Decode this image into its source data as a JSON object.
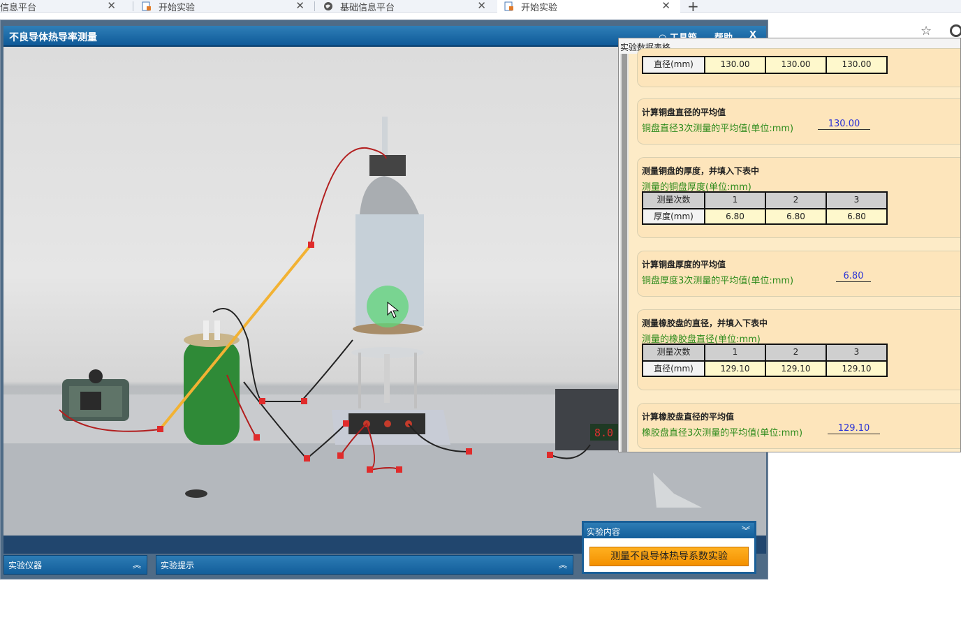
{
  "browser": {
    "tabs": [
      {
        "label": "信息平台"
      },
      {
        "label": "开始实验"
      },
      {
        "label": "基础信息平台"
      },
      {
        "label": "开始实验"
      }
    ],
    "new_tab_label": "+",
    "close_glyph": "✕"
  },
  "sim": {
    "title": "不良导体热导率测量",
    "toolbox_label": "工具箱",
    "help_label": "帮助",
    "close_label": "X",
    "bottom_panels": {
      "instruments_label": "实验仪器",
      "hints_label": "实验提示"
    },
    "content_panel": {
      "header": "实验内容",
      "run_button": "测量不良导体热导系数实验"
    },
    "display_value": "8.0"
  },
  "data_table": {
    "window_title": "实验数据表格",
    "copper_diameter_row": {
      "label": "直径(mm)",
      "values": [
        "130.00",
        "130.00",
        "130.00"
      ]
    },
    "copper_diameter_avg": {
      "title": "计算铜盘直径的平均值",
      "subtitle": "铜盘直径3次测量的平均值(单位:mm)",
      "value": "130.00"
    },
    "copper_thickness": {
      "title": "测量铜盘的厚度，并填入下表中",
      "subtitle": "测量的铜盘厚度(单位:mm)",
      "header": [
        "测量次数",
        "1",
        "2",
        "3"
      ],
      "row": [
        "厚度(mm)",
        "6.80",
        "6.80",
        "6.80"
      ]
    },
    "copper_thickness_avg": {
      "title": "计算铜盘厚度的平均值",
      "subtitle": "铜盘厚度3次测量的平均值(单位:mm)",
      "value": "6.80"
    },
    "rubber_diameter": {
      "title": "测量橡胶盘的直径，并填入下表中",
      "subtitle": "测量的橡胶盘直径(单位:mm)",
      "header": [
        "测量次数",
        "1",
        "2",
        "3"
      ],
      "row": [
        "直径(mm)",
        "129.10",
        "129.10",
        "129.10"
      ]
    },
    "rubber_diameter_avg": {
      "title": "计算橡胶盘直径的平均值",
      "subtitle": "橡胶盘直径3次测量的平均值(单位:mm)",
      "value": "129.10"
    }
  },
  "colors": {
    "title_bar": "#1a6aa8",
    "panel_bg": "#fde5bb",
    "value_blue": "#2b33d6",
    "subtitle_green": "#2e8b1c",
    "run_button": "#f7a00c"
  }
}
